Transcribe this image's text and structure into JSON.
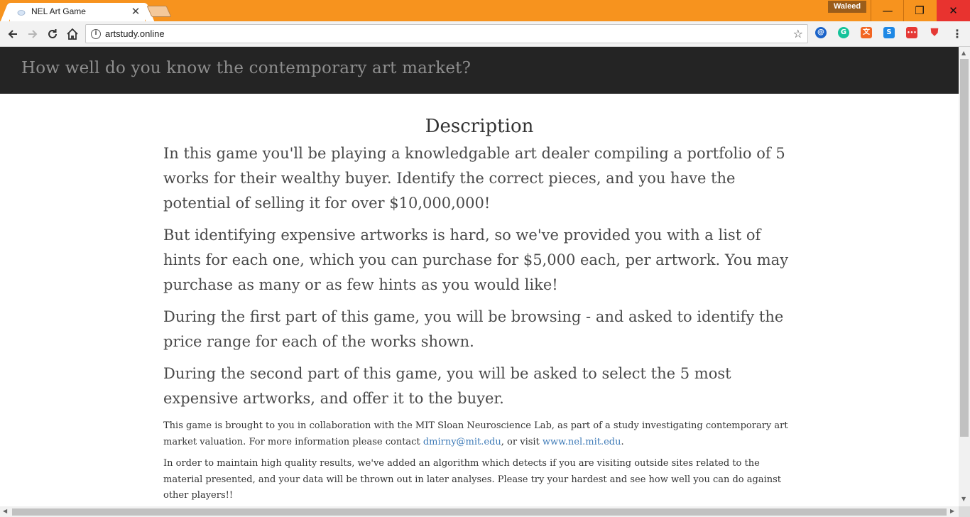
{
  "browser": {
    "tab_title": "NEL Art Game",
    "tab_close": "✕",
    "profile_name": "Waleed",
    "url": "artstudy.online",
    "window_controls": {
      "minimize": "—",
      "restore": "❐",
      "close": "✕"
    },
    "extensions": [
      {
        "name": "adblock-icon",
        "glyph": "@",
        "color": "#1a63c9"
      },
      {
        "name": "grammarly-icon",
        "glyph": "G",
        "color": "#15c39a"
      },
      {
        "name": "translate-icon",
        "glyph": "文",
        "color": "#f26522"
      },
      {
        "name": "s-extension-icon",
        "glyph": "S",
        "color": "#1e88e5"
      },
      {
        "name": "red-extension-icon",
        "glyph": "•••",
        "color": "#e53935"
      },
      {
        "name": "shield-extension-icon",
        "glyph": "⛊",
        "color": "#e53935"
      }
    ],
    "accent_color": "#f7931e"
  },
  "site": {
    "header_title": "How well do you know the contemporary art market?"
  },
  "content": {
    "heading": "Description",
    "paragraphs": [
      "In this game you'll be playing a knowledgable art dealer compiling a portfolio of 5 works for their wealthy buyer. Identify the correct pieces, and you have the potential of selling it for over $10,000,000!",
      "But identifying expensive artworks is hard, so we've provided you with a list of hints for each one, which you can purchase for $5,000 each, per artwork. You may purchase as many or as few hints as you would like!",
      "During the first part of this game, you will be browsing - and asked to identify the price range for each of the works shown.",
      "During the second part of this game, you will be asked to select the 5 most expensive artworks, and offer it to the buyer."
    ],
    "collab": {
      "text_before": "This game is brought to you in collaboration with the MIT Sloan Neuroscience Lab, as part of a study investigating contemporary art market valuation. For more information please contact ",
      "email": "dmirny@mit.edu",
      "text_middle": ", or visit ",
      "website": "www.nel.mit.edu",
      "text_after": "."
    },
    "notice": "In order to maintain high quality results, we've added an algorithm which detects if you are visiting outside sites related to the material presented, and your data will be thrown out in later analyses. Please try your hardest and see how well you can do against other players!!"
  }
}
